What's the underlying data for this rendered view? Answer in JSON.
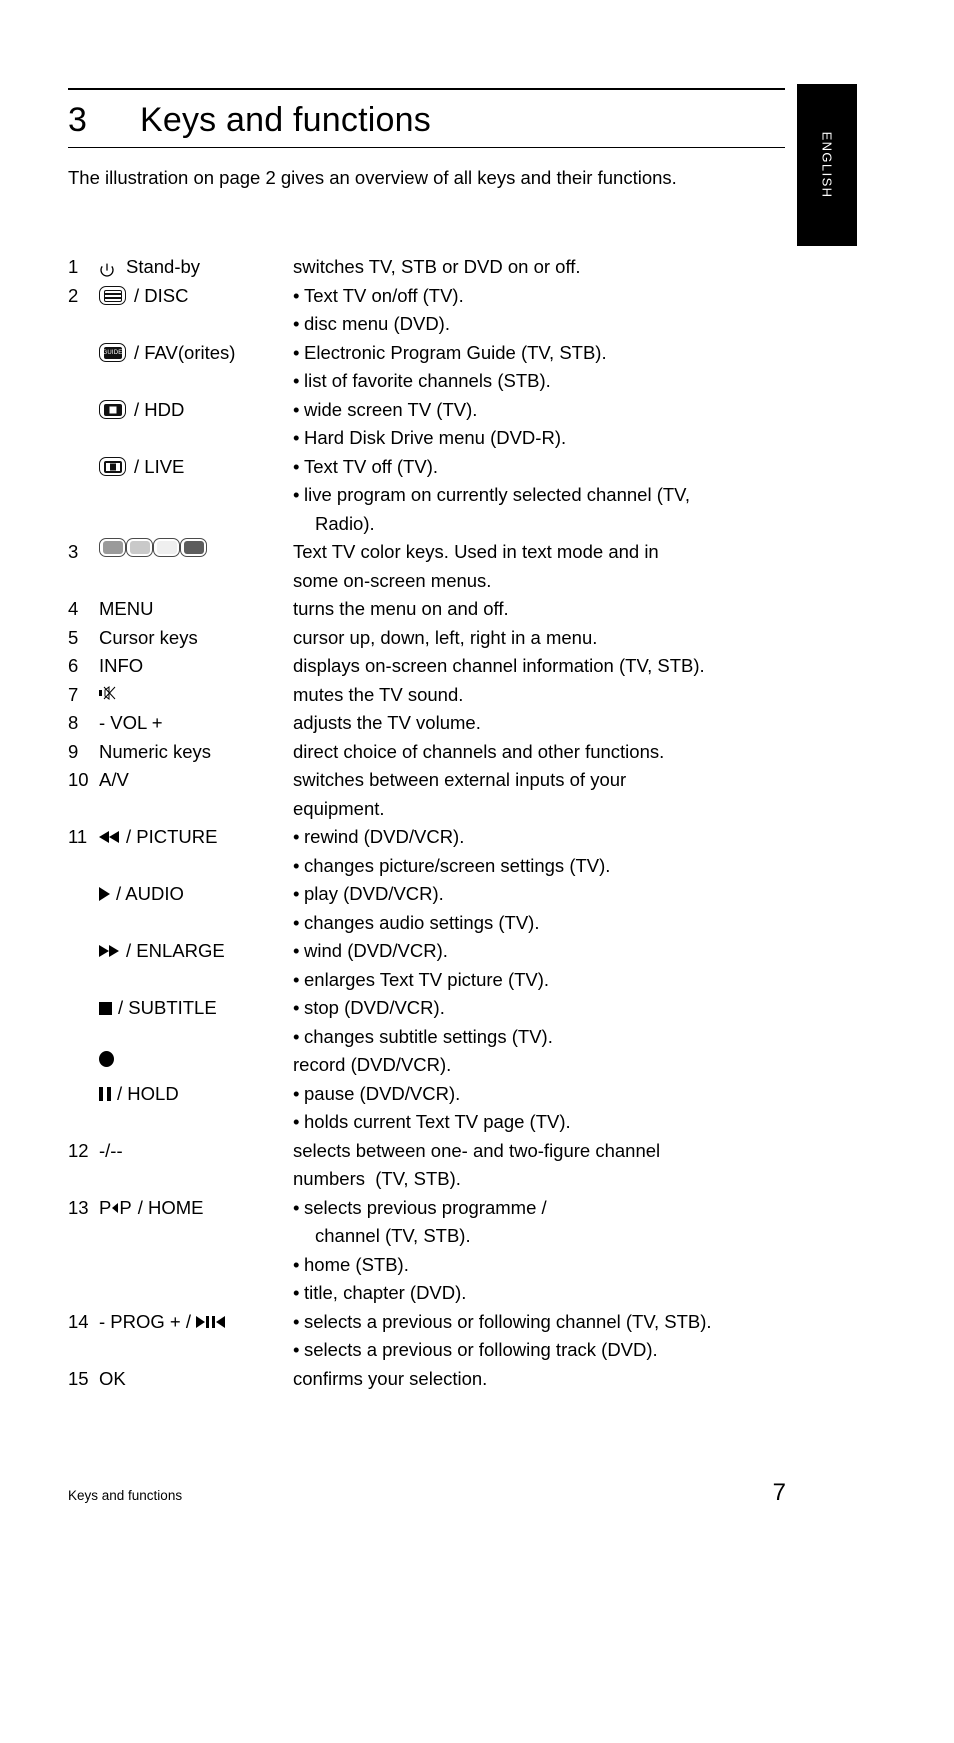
{
  "language_tab": {
    "label": "ENGLISH"
  },
  "heading": {
    "number": "3",
    "title": "Keys and functions"
  },
  "intro": {
    "text": "The illustration on page 2 gives an overview of all keys and their functions."
  },
  "footer": {
    "left": "Keys and functions",
    "page_number": "7"
  },
  "colors": {
    "text": "#000000",
    "tab_background": "#000000",
    "tab_text": "#ffffff",
    "color_key_red": "#9a9a9a",
    "color_key_green": "#c9c9c9",
    "color_key_yellow": "#efefef",
    "color_key_blue": "#5d5d5d"
  },
  "keys": [
    {
      "number": "1",
      "icons": [
        "standby-icon"
      ],
      "key_label": "Stand-by",
      "descriptions": [
        {
          "bullet": false,
          "text": "switches TV, STB or DVD on or off."
        }
      ]
    },
    {
      "number": "2",
      "icons": [
        "teletext-disc-icon"
      ],
      "key_label": "/ DISC",
      "descriptions": [
        {
          "bullet": true,
          "text": "Text TV on/off (TV)."
        },
        {
          "bullet": true,
          "text": "disc menu (DVD)."
        }
      ]
    },
    {
      "number": "",
      "icons": [
        "guide-icon"
      ],
      "key_label": "/ FAV(orites)",
      "descriptions": [
        {
          "bullet": true,
          "text": "Electronic Program Guide (TV, STB)."
        },
        {
          "bullet": true,
          "text": "list of favorite channels (STB)."
        }
      ]
    },
    {
      "number": "",
      "icons": [
        "widescreen-hdd-icon"
      ],
      "key_label": "/ HDD",
      "descriptions": [
        {
          "bullet": true,
          "text": "wide screen TV (TV)."
        },
        {
          "bullet": true,
          "text": "Hard Disk Drive menu (DVD-R)."
        }
      ]
    },
    {
      "number": "",
      "icons": [
        "live-icon"
      ],
      "key_label": "/ LIVE",
      "descriptions": [
        {
          "bullet": true,
          "text": "Text TV off (TV)."
        },
        {
          "bullet": true,
          "text": "live program on currently selected channel (TV,"
        },
        {
          "bullet": false,
          "continuation": true,
          "text": "Radio)."
        }
      ]
    },
    {
      "number": "3",
      "icons": [
        "color-key-red",
        "color-key-green",
        "color-key-yellow",
        "color-key-blue"
      ],
      "key_label": "",
      "descriptions": [
        {
          "bullet": false,
          "text": "Text TV color keys. Used in text mode and in"
        },
        {
          "bullet": false,
          "text": "some on-screen menus."
        }
      ]
    },
    {
      "number": "4",
      "icons": [],
      "key_label": "MENU",
      "descriptions": [
        {
          "bullet": false,
          "text": "turns the menu on and off."
        }
      ]
    },
    {
      "number": "5",
      "icons": [],
      "key_label": "Cursor keys",
      "descriptions": [
        {
          "bullet": false,
          "text": "cursor up, down, left, right in a menu."
        }
      ]
    },
    {
      "number": "6",
      "icons": [],
      "key_label": "INFO",
      "descriptions": [
        {
          "bullet": false,
          "text": "displays on-screen channel information (TV, STB)."
        }
      ]
    },
    {
      "number": "7",
      "icons": [
        "mute-icon"
      ],
      "key_label": "",
      "descriptions": [
        {
          "bullet": false,
          "text": "mutes the TV sound."
        }
      ]
    },
    {
      "number": "8",
      "icons": [],
      "key_label": "- VOL +",
      "descriptions": [
        {
          "bullet": false,
          "text": "adjusts the TV volume."
        }
      ]
    },
    {
      "number": "9",
      "icons": [],
      "key_label": "Numeric keys",
      "descriptions": [
        {
          "bullet": false,
          "text": "direct choice of channels and other functions."
        }
      ]
    },
    {
      "number": "10",
      "icons": [],
      "key_label": "A/V",
      "descriptions": [
        {
          "bullet": false,
          "text": "switches between external inputs of your"
        },
        {
          "bullet": false,
          "text": "equipment."
        }
      ]
    },
    {
      "number": "11",
      "icons": [
        "rewind-icon"
      ],
      "key_label": "/ PICTURE",
      "descriptions": [
        {
          "bullet": true,
          "text": "rewind (DVD/VCR)."
        },
        {
          "bullet": true,
          "text": "changes picture/screen settings (TV)."
        }
      ]
    },
    {
      "number": "",
      "icons": [
        "play-icon"
      ],
      "key_label": "/ AUDIO",
      "descriptions": [
        {
          "bullet": true,
          "text": "play (DVD/VCR)."
        },
        {
          "bullet": true,
          "text": "changes audio settings (TV)."
        }
      ]
    },
    {
      "number": "",
      "icons": [
        "fast-forward-icon"
      ],
      "key_label": "/ ENLARGE",
      "descriptions": [
        {
          "bullet": true,
          "text": "wind (DVD/VCR)."
        },
        {
          "bullet": true,
          "text": "enlarges Text TV picture (TV)."
        }
      ]
    },
    {
      "number": "",
      "icons": [
        "stop-icon"
      ],
      "key_label": "/ SUBTITLE",
      "descriptions": [
        {
          "bullet": true,
          "text": "stop (DVD/VCR)."
        },
        {
          "bullet": true,
          "text": "changes subtitle settings (TV)."
        }
      ]
    },
    {
      "number": "",
      "icons": [
        "record-icon"
      ],
      "key_label": "",
      "descriptions": [
        {
          "bullet": false,
          "text": "record (DVD/VCR)."
        }
      ]
    },
    {
      "number": "",
      "icons": [
        "pause-icon"
      ],
      "key_label": "/ HOLD",
      "descriptions": [
        {
          "bullet": true,
          "text": "pause (DVD/VCR)."
        },
        {
          "bullet": true,
          "text": "holds current Text TV page (TV)."
        }
      ]
    },
    {
      "number": "12",
      "icons": [],
      "key_label": "-/--",
      "descriptions": [
        {
          "bullet": false,
          "text": "selects between one- and two-figure channel"
        },
        {
          "bullet": false,
          "text": "numbers  (TV, STB)."
        }
      ]
    },
    {
      "number": "13",
      "icons": [
        "pip-icon"
      ],
      "key_label": "/ HOME",
      "descriptions": [
        {
          "bullet": true,
          "text": "selects previous programme /"
        },
        {
          "bullet": false,
          "continuation": true,
          "text": "channel (TV, STB)."
        },
        {
          "bullet": true,
          "text": "home (STB)."
        },
        {
          "bullet": true,
          "text": "title, chapter (DVD)."
        }
      ]
    },
    {
      "number": "14",
      "icons": [
        "next-track-icon",
        "prev-track-icon"
      ],
      "key_label": "- PROG + /",
      "descriptions": [
        {
          "bullet": true,
          "text": "selects a previous or following channel (TV, STB)."
        },
        {
          "bullet": true,
          "text": "selects a previous or following track (DVD)."
        }
      ]
    },
    {
      "number": "15",
      "icons": [],
      "key_label": "OK",
      "descriptions": [
        {
          "bullet": false,
          "text": "confirms your selection."
        }
      ]
    }
  ]
}
